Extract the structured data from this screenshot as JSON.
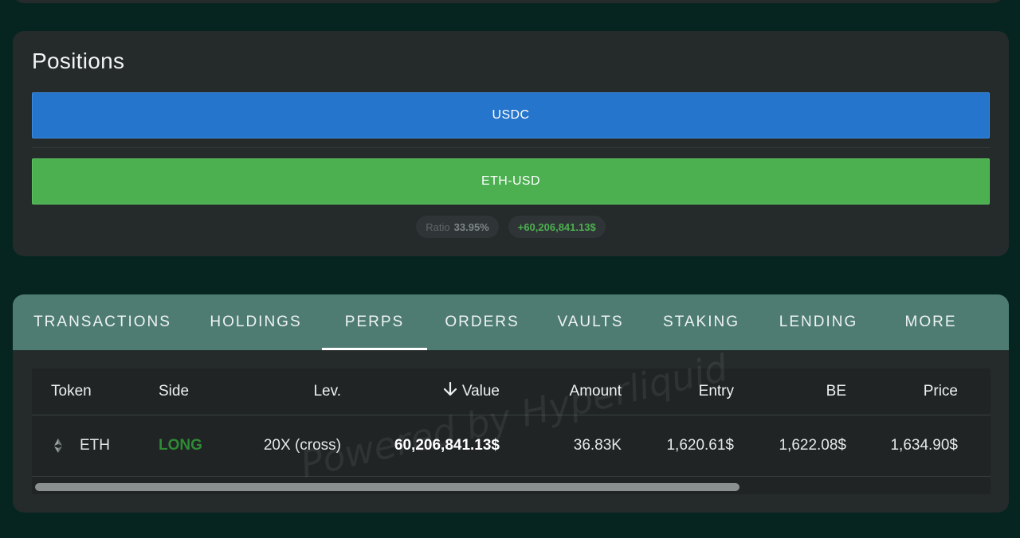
{
  "positions": {
    "title": "Positions",
    "bars": [
      {
        "label": "USDC",
        "color": "#2675cc"
      },
      {
        "label": "ETH-USD",
        "color": "#4caf50"
      }
    ],
    "ratio_label": "Ratio",
    "ratio_value": "33.95%",
    "total_value": "+60,206,841.13$"
  },
  "tabs": [
    {
      "label": "TRANSACTIONS",
      "active": false
    },
    {
      "label": "HOLDINGS",
      "active": false
    },
    {
      "label": "PERPS",
      "active": true
    },
    {
      "label": "ORDERS",
      "active": false
    },
    {
      "label": "VAULTS",
      "active": false
    },
    {
      "label": "STAKING",
      "active": false
    },
    {
      "label": "LENDING",
      "active": false
    },
    {
      "label": "MORE",
      "active": false
    }
  ],
  "table": {
    "columns": [
      "Token",
      "Side",
      "Lev.",
      "Value",
      "Amount",
      "Entry",
      "BE",
      "Price"
    ],
    "sort_column": "Value",
    "sort_icon": "arrow-down-icon",
    "rows": [
      {
        "token": "ETH",
        "token_icon": "ethereum-icon",
        "side": "LONG",
        "lev": "20X (cross)",
        "value": "60,206,841.13$",
        "amount": "36.83K",
        "entry": "1,620.61$",
        "be": "1,622.08$",
        "price": "1,634.90$"
      }
    ],
    "scroll_position": 0.0
  },
  "watermark": "Powered by Hyperliquid",
  "colors": {
    "background": "#062520",
    "card": "#252a2b",
    "tab_bar": "#4e7c73",
    "long": "#2e8b34",
    "positive": "#4caf50"
  }
}
